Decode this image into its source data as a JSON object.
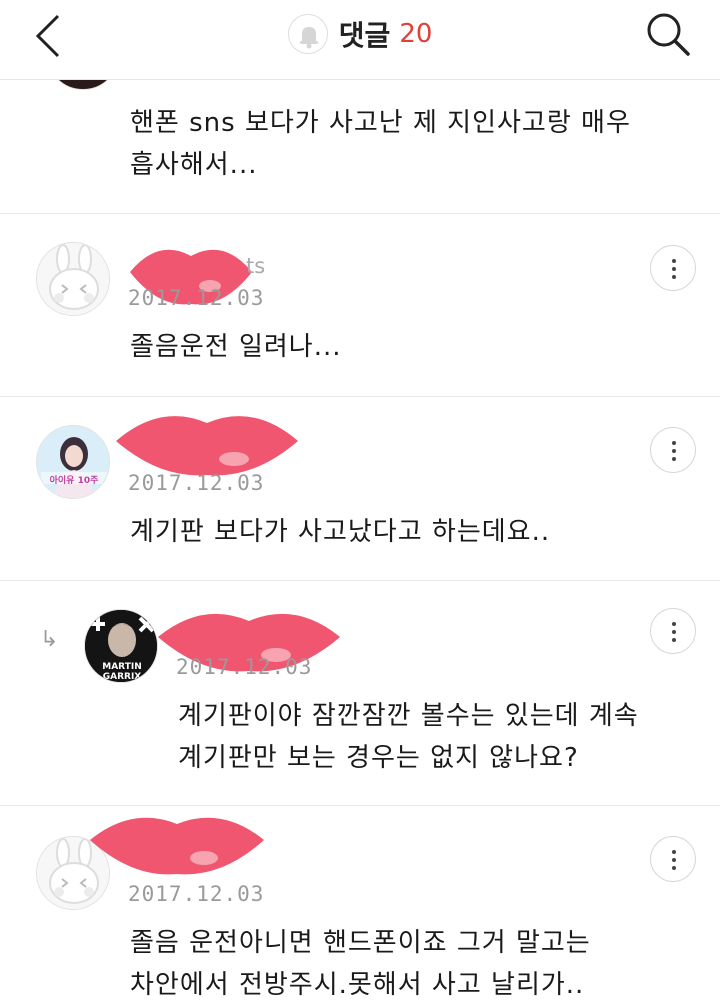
{
  "header": {
    "title": "댓글",
    "count": "20"
  },
  "comments": [
    {
      "text_line1": "핸폰 sns 보다가 사고난 제 지인사고랑 매우",
      "text_line2": "흡사해서..."
    },
    {
      "name_tail": "ts",
      "date": "2017.12.03",
      "text_line1": "졸음운전 일려나..."
    },
    {
      "date": "2017.12.03",
      "avatar_caption": "아이유 10주",
      "text_line1": "계기판 보다가 사고났다고 하는데요.."
    },
    {
      "date": "2017.12.03",
      "avatar_caption_1": "MARTIN",
      "avatar_caption_2": "GARRIX",
      "text_line1": "계기판이야 잠깐잠깐 볼수는 있는데 계속",
      "text_line2": "계기판만 보는 경우는 없지 않나요?"
    },
    {
      "date": "2017.12.03",
      "text_line1": "졸음 운전아니면 핸드폰이죠 그거 말고는",
      "text_line2": "차안에서 전방주시.못해서 사고 날리가.."
    }
  ],
  "colors": {
    "accent": "#e0403a",
    "lips": "#f0566f"
  }
}
